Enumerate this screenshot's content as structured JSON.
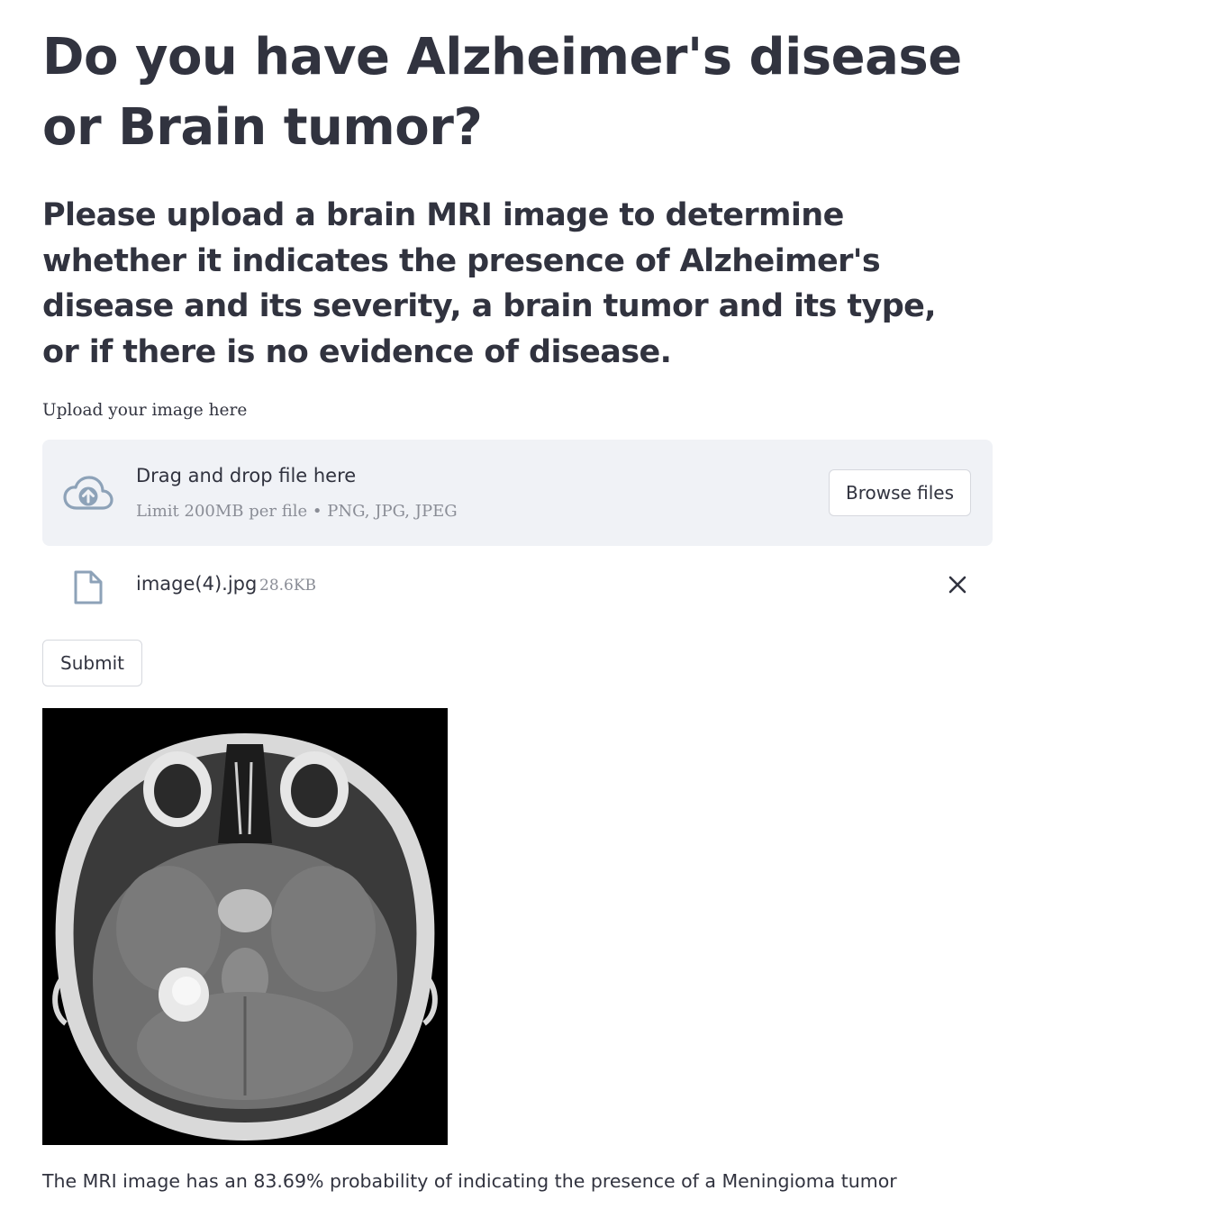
{
  "page": {
    "title": "Do you have Alzheimer's disease or Brain tumor?",
    "subtitle": "Please upload a brain MRI image to determine whether it indicates the presence of Alzheimer's disease and its severity, a brain tumor and its type, or if there is no evidence of disease."
  },
  "uploader": {
    "label": "Upload your image here",
    "drop_title": "Drag and drop file here",
    "drop_limit": "Limit 200MB per file • PNG, JPG, JPEG",
    "browse_label": "Browse files",
    "icon": "cloud-upload-icon"
  },
  "uploaded_file": {
    "name": "image(4).jpg",
    "size": "28.6KB",
    "icon": "file-icon",
    "remove_icon": "close-icon"
  },
  "actions": {
    "submit_label": "Submit"
  },
  "result": {
    "text": "The MRI image has an 83.69% probability of indicating the presence of a Meningioma tumor"
  },
  "colors": {
    "text": "#31333f",
    "muted": "#8a8d96",
    "dropzone_bg": "#f0f2f6",
    "border": "#d6d8de",
    "icon_blue": "#8da2b8"
  }
}
